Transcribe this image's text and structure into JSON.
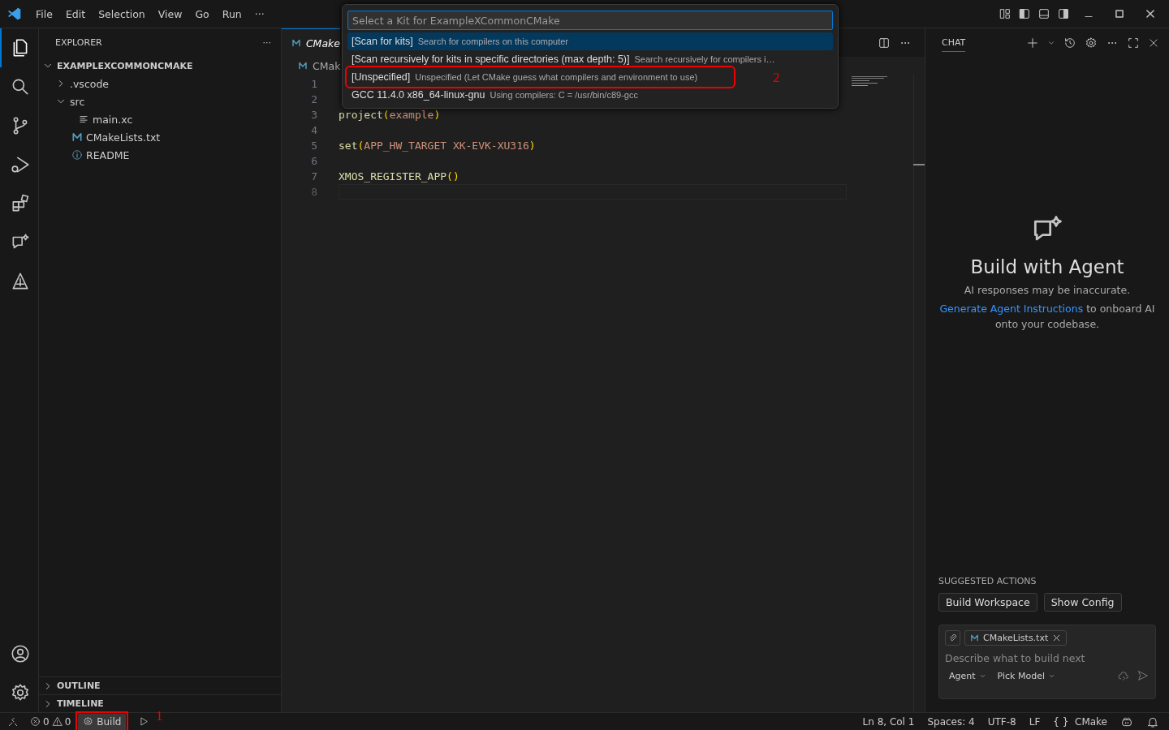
{
  "menu_bar": {
    "items": [
      "File",
      "Edit",
      "Selection",
      "View",
      "Go",
      "Run",
      "···"
    ]
  },
  "activity_bar": {
    "top": [
      {
        "kind": "files",
        "selected": true
      },
      {
        "kind": "search",
        "selected": false
      },
      {
        "kind": "branch",
        "selected": false
      },
      {
        "kind": "debug",
        "selected": false
      },
      {
        "kind": "extensions",
        "selected": false
      },
      {
        "kind": "chat",
        "selected": false
      },
      {
        "kind": "tool",
        "selected": false
      }
    ],
    "bottom": [
      {
        "kind": "account",
        "selected": false
      },
      {
        "kind": "settings",
        "selected": false
      }
    ]
  },
  "explorer": {
    "title": "EXPLORER",
    "more": "···",
    "root": {
      "label": "EXAMPLEXCOMMONCMAKE",
      "expanded": true,
      "children": [
        {
          "label": ".vscode",
          "kind": "folder",
          "expanded": false
        },
        {
          "label": "src",
          "kind": "folder",
          "expanded": true,
          "children": [
            {
              "label": "main.xc",
              "kind": "text"
            }
          ]
        },
        {
          "label": "CMakeLists.txt",
          "kind": "cmake"
        },
        {
          "label": "README",
          "kind": "info"
        }
      ]
    },
    "sections": [
      {
        "label": "OUTLINE",
        "expanded": false
      },
      {
        "label": "TIMELINE",
        "expanded": false
      }
    ]
  },
  "editor": {
    "tab": "CMake",
    "breadcrumb": "CMak",
    "lines": [
      {
        "number": "1",
        "current": false
      },
      {
        "number": "2",
        "current": false
      },
      {
        "number": "3",
        "current": false,
        "tokens": [
          {
            "kind": "func",
            "text": "project"
          },
          {
            "kind": "paren",
            "text": "("
          },
          {
            "kind": "arg",
            "text": "example"
          },
          {
            "kind": "paren",
            "text": ")"
          }
        ]
      },
      {
        "number": "4",
        "current": false
      },
      {
        "number": "5",
        "current": false,
        "tokens": [
          {
            "kind": "func",
            "text": "set"
          },
          {
            "kind": "paren",
            "text": "("
          },
          {
            "kind": "arg",
            "text": "APP_HW_TARGET XK-EVK-XU316"
          },
          {
            "kind": "paren",
            "text": ")"
          }
        ]
      },
      {
        "number": "6",
        "current": false
      },
      {
        "number": "7",
        "current": false,
        "tokens": [
          {
            "kind": "func",
            "text": "XMOS_REGISTER_APP"
          },
          {
            "kind": "paren",
            "text": "()"
          }
        ]
      },
      {
        "number": "8",
        "current": true
      }
    ]
  },
  "quick_pick": {
    "placeholder": "Select a Kit for ExampleXCommonCMake",
    "items": [
      {
        "label": "[Scan for kits]",
        "description": "Search for compilers on this computer",
        "selected": true
      },
      {
        "label": "[Scan recursively for kits in specific directories (max depth: 5)]",
        "description": "Search recursively for compilers i…",
        "selected": false
      },
      {
        "label": "[Unspecified]",
        "description": "Unspecified (Let CMake guess what compilers and environment to use)",
        "selected": false,
        "annotation": "2"
      },
      {
        "label": "GCC 11.4.0 x86_64-linux-gnu",
        "description": "Using compilers: C = /usr/bin/c89-gcc",
        "selected": false
      }
    ]
  },
  "chat": {
    "title": "CHAT",
    "heading": "Build with Agent",
    "note": "AI responses may be inaccurate.",
    "link": "Generate Agent Instructions",
    "link_rest": " to onboard AI onto your codebase.",
    "suggested_title": "SUGGESTED ACTIONS",
    "suggested": [
      "Build Workspace",
      "Show Config"
    ],
    "attachment": "CMakeLists.txt",
    "placeholder": "Describe what to build next",
    "mode": "Agent",
    "model": "Pick Model"
  },
  "status_bar": {
    "errors": "0",
    "warnings": "0",
    "build": {
      "label": "Build",
      "annotation": "1"
    },
    "right": [
      "Ln 8, Col 1",
      "Spaces: 4",
      "UTF-8",
      "LF"
    ],
    "language_icon": "{ }",
    "language": "CMake"
  }
}
